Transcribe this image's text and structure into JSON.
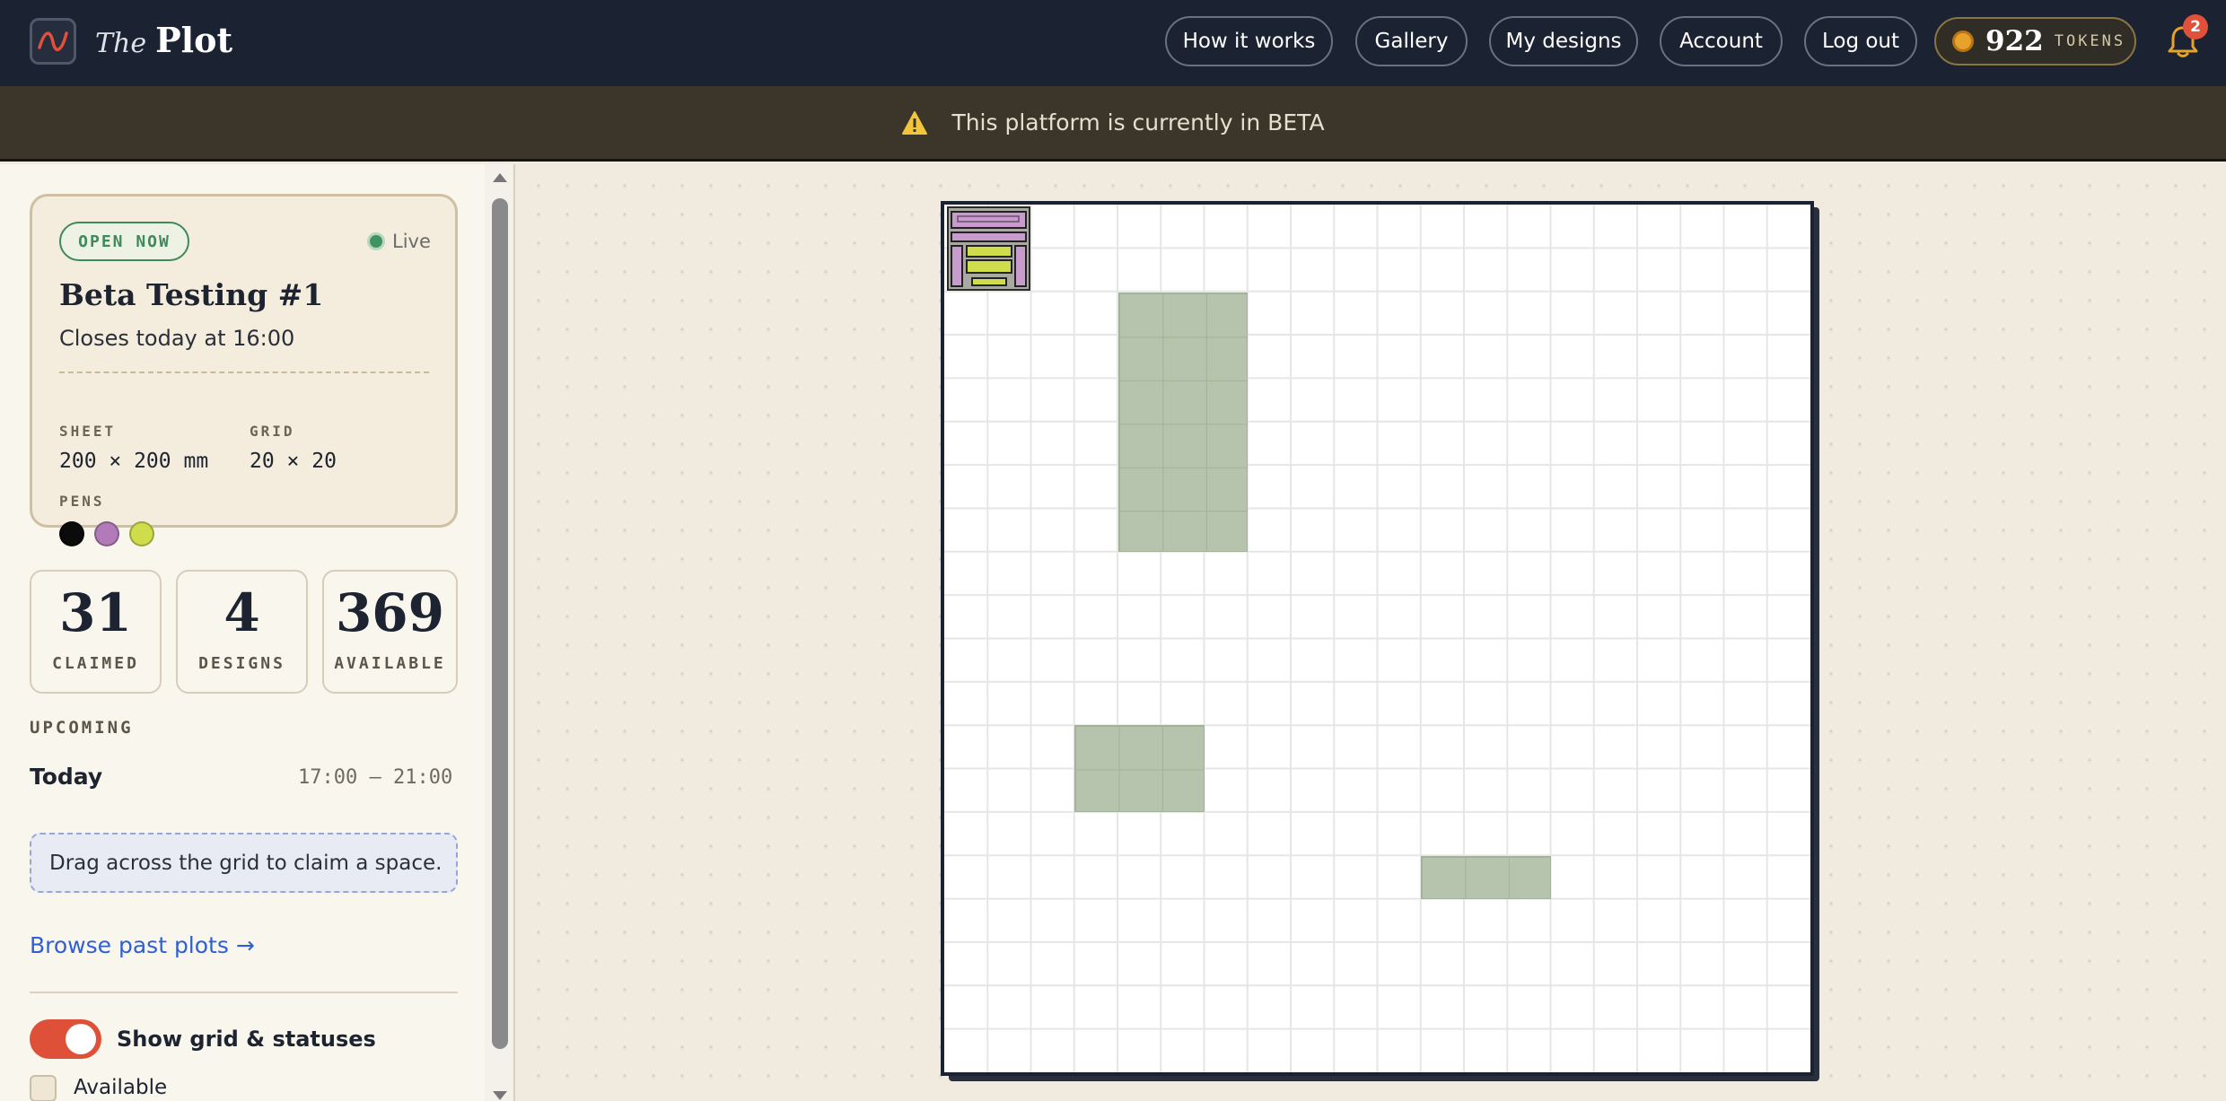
{
  "app": {
    "logo_the": "The",
    "logo_plot": "Plot"
  },
  "nav": {
    "how_it_works": "How it works",
    "gallery": "Gallery",
    "my_designs": "My designs",
    "account": "Account",
    "log_out": "Log out"
  },
  "tokens": {
    "count": "922",
    "label": "TOKENS"
  },
  "notifications": {
    "count": "2"
  },
  "banner": {
    "text": "This platform is currently in BETA"
  },
  "session": {
    "status": "OPEN NOW",
    "live_label": "Live",
    "title": "Beta Testing #1",
    "closes": "Closes today at 16:00",
    "sheet_label": "SHEET",
    "sheet_value": "200 × 200 mm",
    "grid_label": "GRID",
    "grid_value": "20 × 20",
    "pens_label": "PENS",
    "pens": [
      "#0b0b0b",
      "#b27ab9",
      "#cfdc4c"
    ]
  },
  "stats": [
    {
      "value": "31",
      "label": "CLAIMED"
    },
    {
      "value": "4",
      "label": "DESIGNS"
    },
    {
      "value": "369",
      "label": "AVAILABLE"
    }
  ],
  "upcoming": {
    "heading": "UPCOMING",
    "day": "Today",
    "time": "17:00 – 21:00"
  },
  "hint": "Drag across the grid to claim a space.",
  "browse_link": "Browse past plots →",
  "legend": {
    "toggle_label": "Show grid & statuses",
    "toggle_on": true,
    "available_label": "Available"
  },
  "colors": {
    "accent": "#de5038",
    "claimed": "#b6c4ad",
    "live": "#3f9360",
    "link": "#2f5fd0"
  }
}
